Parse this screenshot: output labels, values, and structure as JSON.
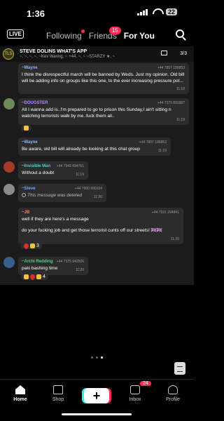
{
  "status_bar": {
    "time": "1:36",
    "battery": "22"
  },
  "top_nav": {
    "live_label": "LIVE",
    "tabs": [
      {
        "label": "Following"
      },
      {
        "label": "Friends",
        "badge": "15"
      },
      {
        "label": "For You"
      }
    ]
  },
  "chat_header": {
    "avatar_text": "TLS",
    "title": "STEVE DOLINS WHAT'S APP",
    "subtitle": "~, ~, ~, ~, ~Kev Waring, ~ +44, ~, ~ ~STARZY ★, ~",
    "page_indicator": "3/3"
  },
  "messages": [
    {
      "name": "~Wayne",
      "phone": "+44 7857 186853",
      "text": "I think the disrespectful march will be banned by Weds. Just my opinion. Old bill will be adding info on groups like this one, to the ever increasing pressure pot...",
      "time": "11:18",
      "name_color": "#8fb4ff"
    },
    {
      "name": "~DOUGSTER",
      "phone": "+44 7379 891887",
      "text": "All I wanna add is..I'm prepared to go to prison this Sunday,I ain't sitting n watching terrorists walk by me..fuck them all..",
      "time": "11:19",
      "name_color": "#b48cff"
    },
    {
      "name": "~Wayne",
      "phone": "+44 7857 186853",
      "text": "Be aware, old bill will already be looking at this chat group",
      "time": "11:19",
      "name_color": "#8fb4ff"
    },
    {
      "name": "~Invisible Man",
      "phone": "+44 7949 894761",
      "text": "Without a doubt",
      "time": "11:19",
      "name_color": "#4fd0d0"
    },
    {
      "name": "~Steve",
      "phone": "+44 7960 990104",
      "text": "This message was deleted",
      "time": "11:20",
      "name_color": "#6fa8ff"
    },
    {
      "name": "~JB",
      "phone": "+44 7931 294841",
      "text_line1": "well if they are here's a message",
      "text_line2": "do your fucking job and get those terrorist cunts off our streets! 🇬🇧🇬🇧",
      "time": "11:20",
      "name_color": "#ff7a5a"
    },
    {
      "name": "~Archi Redding",
      "phone": "+44 7375 942506",
      "text": "paki bashing time",
      "time": "11:20",
      "name_color": "#4fd08a"
    }
  ],
  "reactions": [
    {
      "count": ""
    },
    {
      "count": "3"
    },
    {
      "count": "4"
    }
  ],
  "bottom_nav": {
    "items": [
      {
        "label": "Home"
      },
      {
        "label": "Shop"
      },
      {
        "label": "Inbox",
        "badge": "24"
      },
      {
        "label": "Profile"
      }
    ],
    "create_symbol": "+"
  }
}
